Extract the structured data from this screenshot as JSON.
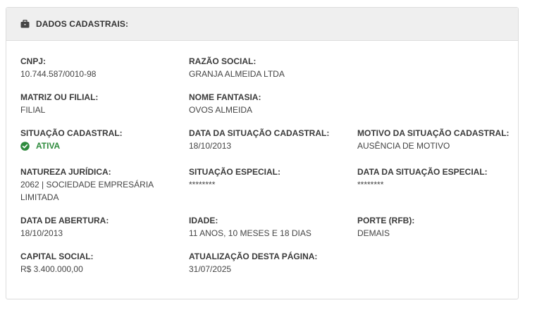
{
  "header": {
    "title": "DADOS CADASTRAIS:",
    "icon": "briefcase-icon"
  },
  "fields": {
    "cnpj": {
      "label": "CNPJ:",
      "value": "10.744.587/0010-98"
    },
    "razao_social": {
      "label": "RAZÃO SOCIAL:",
      "value": "GRANJA ALMEIDA LTDA"
    },
    "matriz_filial": {
      "label": "MATRIZ OU FILIAL:",
      "value": "FILIAL"
    },
    "nome_fantasia": {
      "label": "NOME FANTASIA:",
      "value": "OVOS ALMEIDA"
    },
    "situacao_cadastral": {
      "label": "SITUAÇÃO CADASTRAL:",
      "value": "ATIVA",
      "status_color": "#2e8b3d",
      "icon": "check-circle-icon"
    },
    "data_situacao_cadastral": {
      "label": "DATA DA SITUAÇÃO CADASTRAL:",
      "value": "18/10/2013"
    },
    "motivo_situacao_cadastral": {
      "label": "MOTIVO DA SITUAÇÃO CADASTRAL:",
      "value": "AUSÊNCIA DE MOTIVO"
    },
    "natureza_juridica": {
      "label": "NATUREZA JURÍDICA:",
      "value_line1": "2062 | SOCIEDADE EMPRESÁRIA",
      "value_line2": "LIMITADA"
    },
    "situacao_especial": {
      "label": "SITUAÇÃO ESPECIAL:",
      "value": "********"
    },
    "data_situacao_especial": {
      "label": "DATA DA SITUAÇÃO ESPECIAL:",
      "value": "********"
    },
    "data_abertura": {
      "label": "DATA DE ABERTURA:",
      "value": "18/10/2013"
    },
    "idade": {
      "label": "IDADE:",
      "value": "11 ANOS, 10 MESES E 18 DIAS"
    },
    "porte": {
      "label": "PORTE (RFB):",
      "value": "DEMAIS"
    },
    "capital_social": {
      "label": "CAPITAL SOCIAL:",
      "value": "R$ 3.400.000,00"
    },
    "atualizacao": {
      "label": "ATUALIZAÇÃO DESTA PÁGINA:",
      "value": "31/07/2025"
    }
  }
}
